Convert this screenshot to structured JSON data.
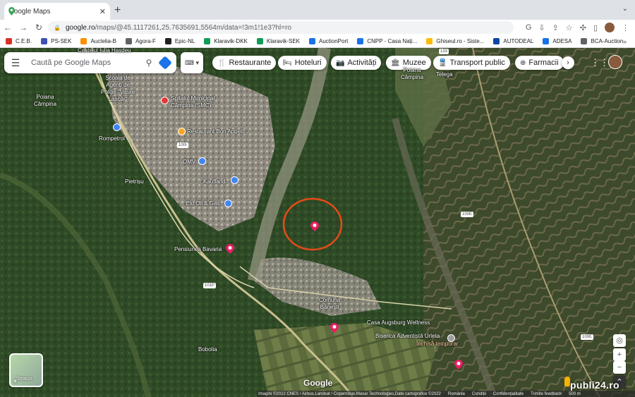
{
  "browser": {
    "tab_title": "Google Maps",
    "new_tab": "+",
    "url_host": "google.ro",
    "url_rest": "/maps/@45.1117261,25.7635691,5564m/data=!3m1!1e3?hl=ro",
    "bookmarks": [
      "C.E.B.",
      "PS-SEK",
      "Auctelia-B",
      "Agora-F",
      "Epic-NL",
      "Klaravik-DKK",
      "Klaravik-SEK",
      "AuctionPort",
      "CNPP - Casa Nați...",
      "Ghiseul.ro - Siste...",
      "AUTODEAL",
      "ADESA",
      "BCA-Auction"
    ],
    "bookmark_colors": [
      "#d93025",
      "#3f51b5",
      "#ff8f00",
      "#5f6368",
      "#202124",
      "#0f9d58",
      "#0f9d58",
      "#1a73e8",
      "#1a73e8",
      "#fbbc04",
      "#0d47a1",
      "#1a73e8",
      "#5f6368"
    ]
  },
  "search": {
    "placeholder": "Caută pe Google Maps"
  },
  "chips": [
    "Restaurante",
    "Hoteluri",
    "Activități",
    "Muzee",
    "Transport public",
    "Farmacii"
  ],
  "chip_icons": [
    "🍴",
    "🛏",
    "📷",
    "🏛",
    "🚆",
    "⊕"
  ],
  "places": {
    "castelul": "Castelul Iulia Hasdeu",
    "scoala": "Școala de\nAgenți de\nPoliție \"Vasile\nLascăr\"",
    "spital": "Spitalul Municipal\nCâmpina (SMC)",
    "restaurant": "Restaurant Bon Appetit",
    "omv": "OMV",
    "kaufland": "Kaufland",
    "etu": "Etu Oil & Gas",
    "pietrisu": "Pietrișu",
    "rompetrol": "Rompetrol",
    "poiana_left": "Poiana\nCâmpina",
    "poiana_right": "Poiana\nCâmpina",
    "telega": "Telega",
    "pensiunea": "Pensiunea Bavaria",
    "banesti": "Comuna\nBănești",
    "casa": "Casa Augsburg Wellness",
    "biserica": "Biserica Adventistă Urleta",
    "biserica_sub": "Închisă temporar",
    "bobolia": "Bobolia"
  },
  "road_shields": [
    "100I",
    "100E",
    "100E",
    "101P",
    "133"
  ],
  "layers_label": "Straturi",
  "google_logo": "Google",
  "attribution": [
    "Imagini ©2022 CNES / Airbus,Landsat / Copernicus,Maxar Technologies,Date cartografice ©2022",
    "România",
    "Condiții",
    "Confidențialitate",
    "Trimite feedback",
    "500 m"
  ],
  "watermark": "publi24.ro",
  "colors": {
    "highlight_circle": "#e64a19",
    "pin": "#e91e63",
    "poi_blue": "#4285f4",
    "poi_orange": "#f9a825"
  }
}
